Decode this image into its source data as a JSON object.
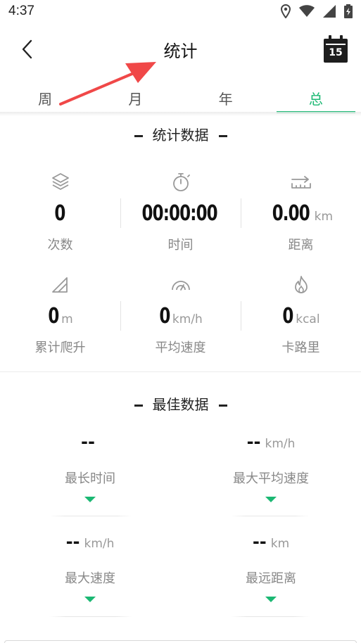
{
  "status_bar": {
    "time": "4:37"
  },
  "header": {
    "title": "统计",
    "calendar_day": "15"
  },
  "tabs": [
    {
      "label": "周",
      "active": false
    },
    {
      "label": "月",
      "active": false
    },
    {
      "label": "年",
      "active": false
    },
    {
      "label": "总",
      "active": true
    }
  ],
  "stats": {
    "title": "统计数据",
    "items": [
      {
        "icon": "layers-icon",
        "value": "0",
        "unit": "",
        "label": "次数"
      },
      {
        "icon": "stopwatch-icon",
        "value": "00:00:00",
        "unit": "",
        "label": "时间"
      },
      {
        "icon": "distance-ruler-icon",
        "value": "0.00",
        "unit": "km",
        "label": "距离"
      },
      {
        "icon": "climb-icon",
        "value": "0",
        "unit": "m",
        "label": "累计爬升"
      },
      {
        "icon": "speedometer-icon",
        "value": "0",
        "unit": "km/h",
        "label": "平均速度"
      },
      {
        "icon": "flame-icon",
        "value": "0",
        "unit": "kcal",
        "label": "卡路里"
      }
    ]
  },
  "best": {
    "title": "最佳数据",
    "items": [
      {
        "value": "--",
        "unit": "",
        "label": "最长时间"
      },
      {
        "value": "--",
        "unit": "km/h",
        "label": "最大平均速度"
      },
      {
        "value": "--",
        "unit": "km/h",
        "label": "最大速度"
      },
      {
        "value": "--",
        "unit": "km",
        "label": "最远距离"
      }
    ]
  },
  "colors": {
    "accent": "#1bb873",
    "annotation_arrow": "#f04848"
  }
}
